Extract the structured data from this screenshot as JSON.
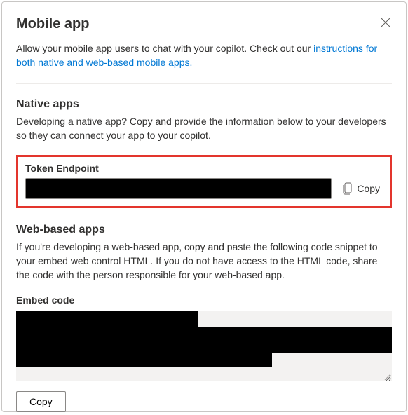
{
  "header": {
    "title": "Mobile app"
  },
  "intro": {
    "text_before": "Allow your mobile app users to chat with your copilot. Check out our ",
    "link_text": "instructions for both native and web-based mobile apps.",
    "text_after": ""
  },
  "native": {
    "title": "Native apps",
    "desc": "Developing a native app? Copy and provide the information below to your developers so they can connect your app to your copilot.",
    "token_label": "Token Endpoint",
    "token_value": "",
    "copy_label": "Copy"
  },
  "web": {
    "title": "Web-based apps",
    "desc": "If you're developing a web-based app, copy and paste the following code snippet to your embed web control HTML. If you do not have access to the HTML code, share the code with the person responsible for your web-based app.",
    "embed_label": "Embed code",
    "embed_value": "",
    "copy_label": "Copy"
  }
}
